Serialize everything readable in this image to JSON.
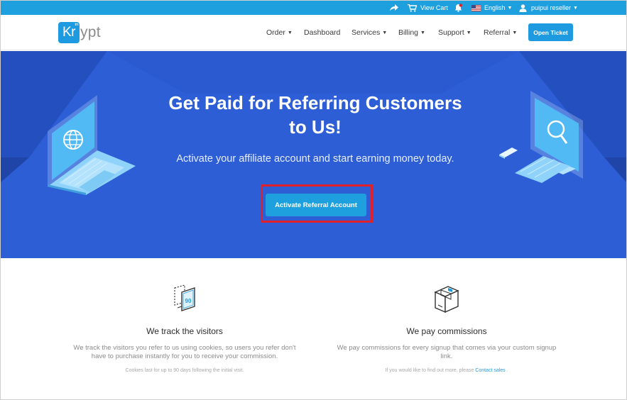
{
  "topbar": {
    "cart_label": "View Cart",
    "language_label": "English",
    "user_label": "puipui reseller"
  },
  "header": {
    "logo_prefix": "Kr",
    "logo_suffix": "ypt",
    "logo_mark": "tm",
    "nav": {
      "order": "Order",
      "dashboard": "Dashboard",
      "services": "Services",
      "billing": "Billing",
      "support": "Support",
      "referral": "Referral"
    },
    "open_ticket": "Open Ticket"
  },
  "hero": {
    "title_line1": "Get Paid for Referring Customers",
    "title_line2": "to Us!",
    "subtitle": "Activate your affiliate account and start earning money today.",
    "cta": "Activate Referral Account"
  },
  "features": {
    "left": {
      "title": "We track the visitors",
      "desc_line1": "We track the visitors you refer to us using cookies, so users you refer don't",
      "desc_line2": "have to purchase instantly for you to receive your commission.",
      "note": "Cookies last for up to 90 days following the initial visit.",
      "icon_text": "90"
    },
    "right": {
      "title": "We pay commissions",
      "desc_line1": "We pay commissions for every signup that comes via your custom signup",
      "desc_line2": "link.",
      "note_prefix": "If you would like to find out more, please ",
      "note_link": "Contact sales",
      "note_suffix": " ."
    }
  },
  "colors": {
    "accent": "#1ea0df",
    "hero_bg": "#2d5ed6",
    "highlight": "#e0202a"
  }
}
